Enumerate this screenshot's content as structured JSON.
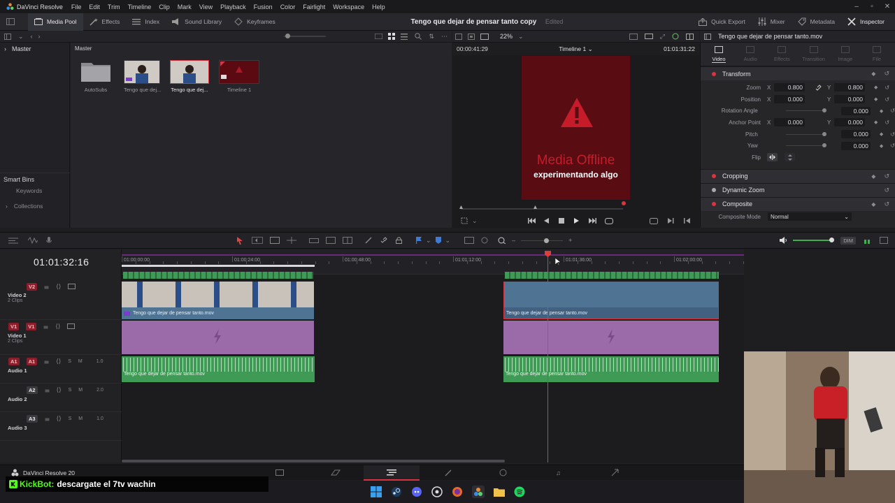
{
  "app": {
    "name": "DaVinci Resolve",
    "menu": [
      "File",
      "Edit",
      "Trim",
      "Timeline",
      "Clip",
      "Mark",
      "View",
      "Playback",
      "Fusion",
      "Color",
      "Fairlight",
      "Workspace",
      "Help"
    ]
  },
  "toolbar": {
    "media_pool": "Media Pool",
    "effects": "Effects",
    "index": "Index",
    "sound_library": "Sound Library",
    "keyframes": "Keyframes",
    "project_title": "Tengo que dejar de pensar tanto copy",
    "edited": "Edited",
    "quick_export": "Quick Export",
    "mixer": "Mixer",
    "metadata": "Metadata",
    "inspector": "Inspector"
  },
  "media_pool": {
    "master": "Master",
    "breadcrumb": "Master",
    "smart_bins": "Smart Bins",
    "keywords": "Keywords",
    "collections": "Collections",
    "items": [
      {
        "label": "AutoSubs",
        "kind": "folder"
      },
      {
        "label": "Tengo que dej...",
        "kind": "video"
      },
      {
        "label": "Tengo que dej...",
        "kind": "video-selected"
      },
      {
        "label": "Timeline 1",
        "kind": "timeline"
      }
    ]
  },
  "viewer": {
    "zoom": "22%",
    "source_tc": "00:00:41:29",
    "timeline_name": "Timeline 1",
    "record_tc": "01:01:31:22",
    "offline_text": "Media Offline",
    "subtitle": "experimentando algo"
  },
  "inspector": {
    "clip_name": "Tengo que dejar de pensar tanto.mov",
    "tabs": [
      "Video",
      "Audio",
      "Effects",
      "Transition",
      "Image",
      "File"
    ],
    "transform": {
      "title": "Transform",
      "zoom_label": "Zoom",
      "zoom_x": "0.800",
      "zoom_y": "0.800",
      "position_label": "Position",
      "position_x": "0.000",
      "position_y": "0.000",
      "rotation_label": "Rotation Angle",
      "rotation": "0.000",
      "anchor_label": "Anchor Point",
      "anchor_x": "0.000",
      "anchor_y": "0.000",
      "pitch_label": "Pitch",
      "pitch": "0.000",
      "yaw_label": "Yaw",
      "yaw": "0.000",
      "flip_label": "Flip",
      "x_axis": "X",
      "y_axis": "Y"
    },
    "cropping": "Cropping",
    "dynamic_zoom": "Dynamic Zoom",
    "composite": "Composite",
    "composite_mode_label": "Composite Mode",
    "composite_mode": "Normal"
  },
  "timeline": {
    "timecode": "01:01:32:16",
    "ruler": [
      "01:00:00:00",
      "01:00:24:00",
      "01:00:48:00",
      "01:01:12:00",
      "01:01:36:00",
      "01:02:00:00",
      "01:02:24:00"
    ],
    "dim": "DIM",
    "tracks": [
      {
        "id": "V2",
        "name": "Video 2",
        "clips": "2 Clips"
      },
      {
        "id": "V1",
        "name": "Video 1",
        "clips": "2 Clips",
        "src": "V1"
      },
      {
        "id": "A1",
        "name": "Audio 1",
        "level": "1.0",
        "src": "A1"
      },
      {
        "id": "A2",
        "name": "Audio 2",
        "level": "2.0"
      },
      {
        "id": "A3",
        "name": "Audio 3",
        "level": "1.0"
      }
    ],
    "clip_v2": "Tengo que dejar de pensar tanto.mov",
    "clip_a1": "Tengo que dejar de pensar tanto.mov",
    "solo": "S",
    "mute": "M"
  },
  "footer": {
    "app_version": "DaVinci Resolve 20"
  },
  "chat": {
    "user": "KickBot:",
    "message": "descargate el 7tv wachin"
  },
  "colors": {
    "accent_red": "#d9343f",
    "video_clip_blue": "#4f7493",
    "solid_clip_purple": "#9b6aa8",
    "audio_clip_green": "#3f9a55",
    "playhead": "#e23b3b"
  }
}
